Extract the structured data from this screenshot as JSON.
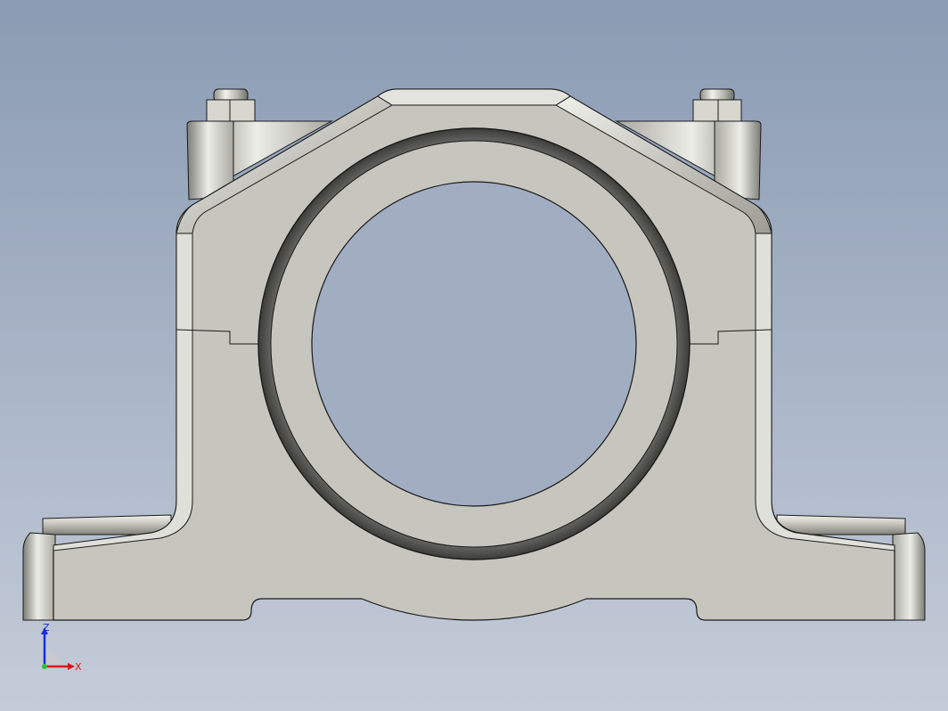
{
  "viewport": {
    "view": "front",
    "background_top": "#8a9bb3",
    "background_bottom": "#c5ccd9"
  },
  "model": {
    "body_color": "#c6c6bf",
    "edge_color": "#1a1a1a",
    "bore_color": "#a1adc1",
    "groove_color": "#5f605b"
  },
  "triad": {
    "z_label": "Z",
    "x_label": "X",
    "z_color": "#1a2fd8",
    "x_color": "#d81a1a"
  }
}
